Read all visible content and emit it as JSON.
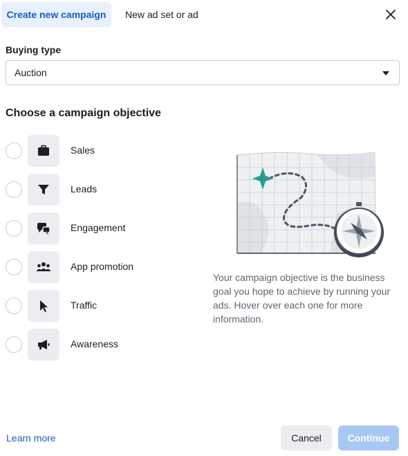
{
  "tabs": {
    "active": "Create new campaign",
    "other": "New ad set or ad"
  },
  "buying_type": {
    "label": "Buying type",
    "selected": "Auction"
  },
  "objective_section": {
    "title": "Choose a campaign objective",
    "objectives": [
      {
        "label": "Sales",
        "icon": "briefcase-icon"
      },
      {
        "label": "Leads",
        "icon": "filter-icon"
      },
      {
        "label": "Engagement",
        "icon": "chat-bubbles-icon"
      },
      {
        "label": "App promotion",
        "icon": "people-icon"
      },
      {
        "label": "Traffic",
        "icon": "cursor-icon"
      },
      {
        "label": "Awareness",
        "icon": "megaphone-icon"
      }
    ],
    "description": "Your campaign objective is the business goal you hope to achieve by running your ads. Hover over each one for more information."
  },
  "footer": {
    "learn_more": "Learn more",
    "cancel": "Cancel",
    "continue": "Continue"
  },
  "colors": {
    "accent": "#1a5dc2",
    "active_tab_bg": "#e7f0fb",
    "disabled_button": "#a8c8f4",
    "teal_marker": "#2a9d8f"
  }
}
